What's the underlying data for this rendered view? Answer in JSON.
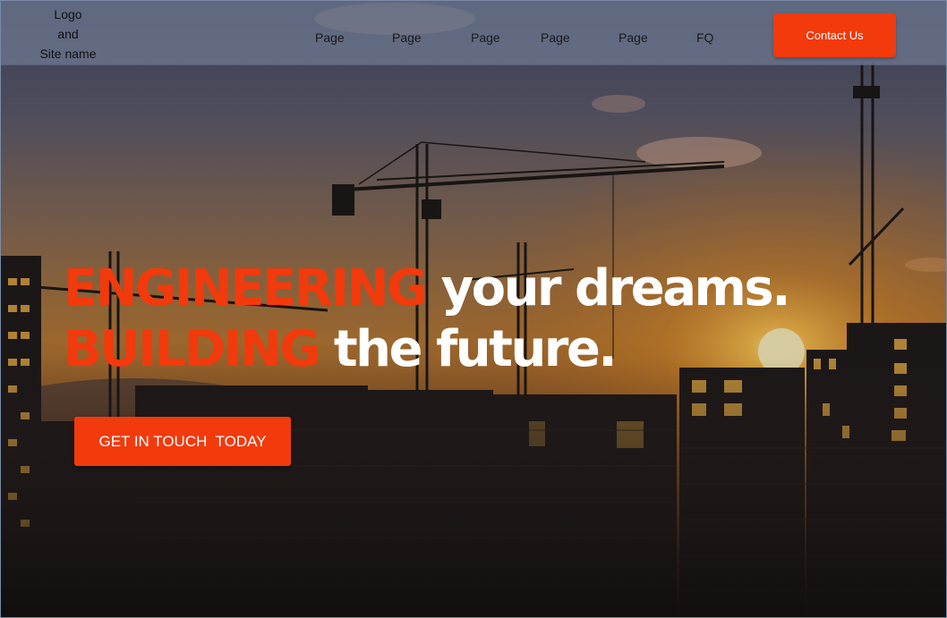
{
  "header": {
    "logo_lines": [
      "Logo",
      "and",
      "Site name"
    ],
    "nav": [
      "Page",
      "Page",
      "Page",
      "Page",
      "Page",
      "FQ"
    ],
    "contact_label": "Contact Us"
  },
  "hero": {
    "line1_accent": "ENGINEERING",
    "line1_rest": " your dreams.",
    "line2_accent": "BUILDING",
    "line2_rest": " the future.",
    "cta_label": "GET IN TOUCH  TODAY"
  },
  "colors": {
    "accent": "#f23a0c",
    "header_bg": "#7882a0",
    "headline_white": "#ffffff"
  }
}
